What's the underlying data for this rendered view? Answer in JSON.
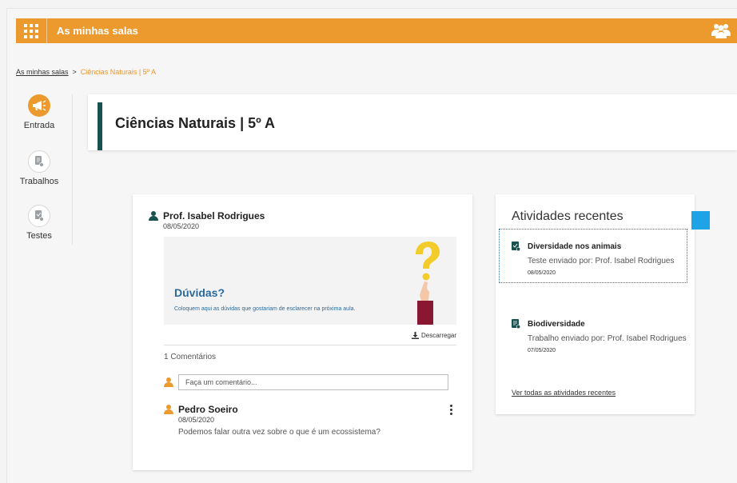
{
  "topbar": {
    "title": "As minhas salas",
    "apps_icon": "grid-icon",
    "users_icon": "users-icon"
  },
  "breadcrumb": {
    "root": "As minhas salas",
    "separator": ">",
    "current": "Ciências Naturais | 5º A"
  },
  "sidenav": {
    "items": [
      {
        "label": "Entrada",
        "icon": "megaphone-icon",
        "active": true
      },
      {
        "label": "Trabalhos",
        "icon": "assignment-icon",
        "active": false
      },
      {
        "label": "Testes",
        "icon": "test-icon",
        "active": false
      }
    ]
  },
  "page": {
    "title": "Ciências Naturais | 5º A"
  },
  "post": {
    "author": "Prof. Isabel Rodrigues",
    "date": "08/05/2020",
    "banner_title": "Dúvidas?",
    "banner_text": "Coloquem aqui as dúvidas que gostariam de esclarecer na próxima aula.",
    "download_label": "Descarregar",
    "comment_count": "1 Comentários",
    "comment_placeholder": "Faça um comentário...",
    "comments": [
      {
        "author": "Pedro Soeiro",
        "date": "08/05/2020",
        "text": "Podemos falar outra vez sobre o que é um ecossistema?"
      }
    ]
  },
  "activities": {
    "title": "Atividades recentes",
    "items": [
      {
        "name": "Diversidade nos animais",
        "description": "Teste enviado por: Prof. Isabel Rodrigues",
        "date": "08/05/2020",
        "icon": "test-icon"
      },
      {
        "name": "Biodiversidade",
        "description": "Trabalho enviado por: Prof. Isabel Rodrigues",
        "date": "07/05/2020",
        "icon": "assignment-icon"
      }
    ],
    "see_all": "Ver todas as atividades recentes"
  },
  "colors": {
    "brand": "#ec9a2e",
    "accent": "#17524f",
    "link_blue": "#2a6a9e",
    "focus": "#1ea4e6"
  }
}
